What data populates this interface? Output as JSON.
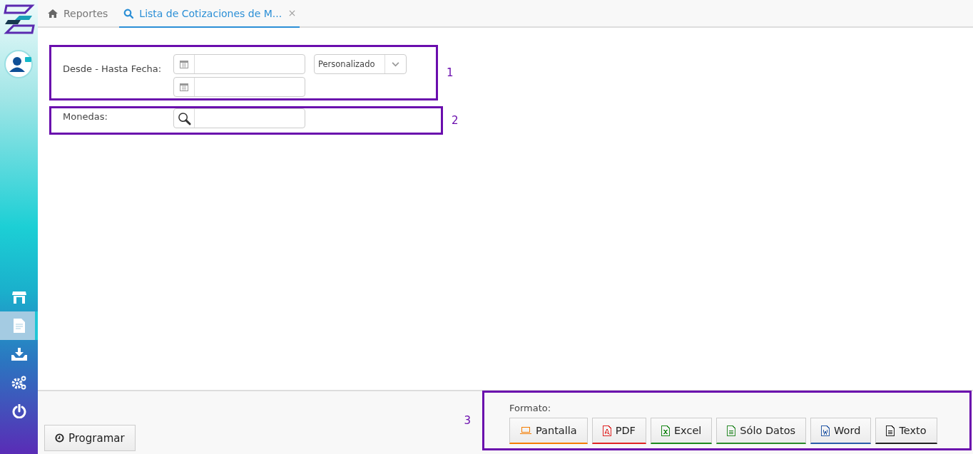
{
  "sidebar": {
    "nav_items": [
      {
        "kind": "store",
        "selected": false
      },
      {
        "kind": "document",
        "selected": true
      },
      {
        "kind": "download",
        "selected": false
      },
      {
        "kind": "gears",
        "selected": false
      },
      {
        "kind": "power",
        "selected": false
      }
    ]
  },
  "tabs": [
    {
      "label": "Reportes",
      "kind": "home",
      "selected": false,
      "closable": false
    },
    {
      "label": "Lista de Cotizaciones de M...",
      "kind": "search",
      "selected": true,
      "closable": true
    }
  ],
  "sections": [
    {
      "annotation": "1",
      "label": "Desde - Hasta Fecha:",
      "inputs": [
        {
          "kind": "date"
        },
        {
          "kind": "date"
        }
      ],
      "dropdown": {
        "value": "Personalizado"
      }
    },
    {
      "annotation": "2",
      "label": "Monedas:",
      "inputs": [
        {
          "kind": "lookup"
        }
      ]
    }
  ],
  "footer": {
    "schedule_button": "Programar",
    "format_panel": {
      "annotation": "3",
      "label": "Formato:",
      "buttons": [
        {
          "label": "Pantalla",
          "kind": "screen",
          "color": "#f57c00"
        },
        {
          "label": "PDF",
          "kind": "pdf",
          "color": "#e02424"
        },
        {
          "label": "Excel",
          "kind": "excel",
          "color": "#1e8a1e"
        },
        {
          "label": "Sólo Datos",
          "kind": "data",
          "color": "#2a8a2a"
        },
        {
          "label": "Word",
          "kind": "word",
          "color": "#2b5ca8"
        },
        {
          "label": "Texto",
          "kind": "text",
          "color": "#222222"
        }
      ]
    }
  }
}
